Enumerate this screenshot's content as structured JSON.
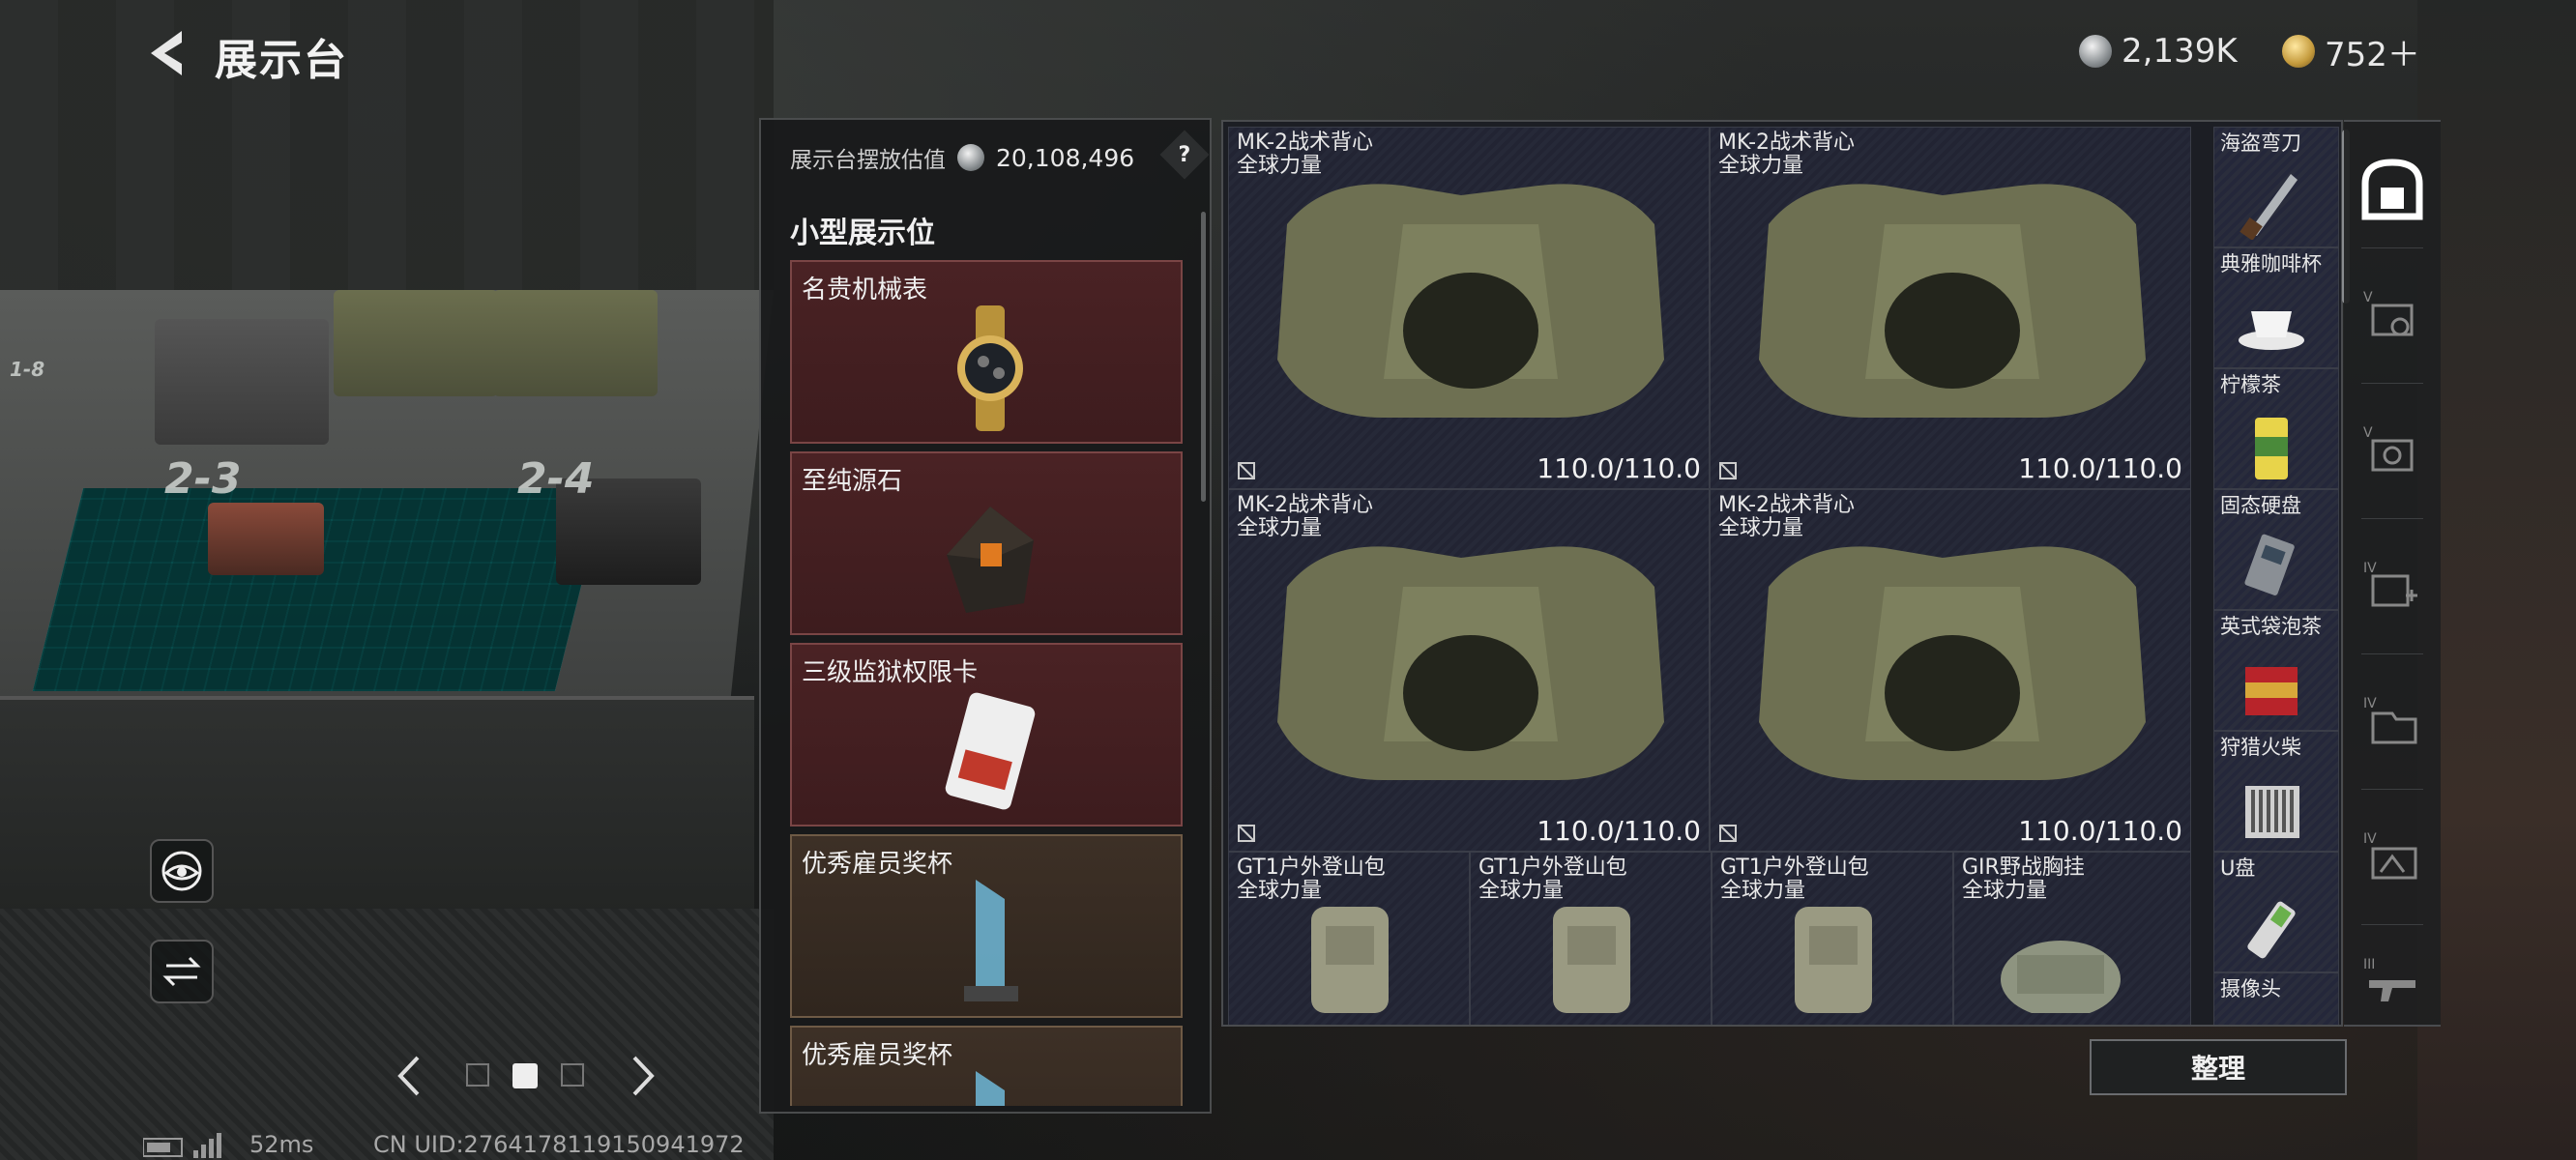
{
  "header": {
    "title": "展示台",
    "silver_amount": "2,139K",
    "gold_amount": "752＋"
  },
  "display_panel": {
    "value_label": "展示台摆放估值",
    "value_amount": "20,108,496",
    "help": "?",
    "section_title": "小型展示位",
    "slots": [
      {
        "name": "名贵机械表",
        "icon": "gold-watch-icon"
      },
      {
        "name": "至纯源石",
        "icon": "source-stone-icon"
      },
      {
        "name": "三级监狱权限卡",
        "icon": "access-card-icon"
      },
      {
        "name": "优秀雇员奖杯",
        "icon": "trophy-icon"
      },
      {
        "name": "优秀雇员奖杯",
        "icon": "trophy-icon"
      }
    ]
  },
  "warehouse": {
    "large_items": [
      {
        "name": "MK-2战术背心",
        "faction": "全球力量",
        "durability": "110.0/110.0"
      },
      {
        "name": "MK-2战术背心",
        "faction": "全球力量",
        "durability": "110.0/110.0"
      },
      {
        "name": "MK-2战术背心",
        "faction": "全球力量",
        "durability": "110.0/110.0"
      },
      {
        "name": "MK-2战术背心",
        "faction": "全球力量",
        "durability": "110.0/110.0"
      }
    ],
    "bags": [
      {
        "name": "GT1户外登山包",
        "faction": "全球力量"
      },
      {
        "name": "GT1户外登山包",
        "faction": "全球力量"
      },
      {
        "name": "GT1户外登山包",
        "faction": "全球力量"
      },
      {
        "name": "GIR野战胸挂",
        "faction": "全球力量"
      }
    ],
    "small_items": [
      {
        "name": "海盗弯刀",
        "icon": "knife-icon"
      },
      {
        "name": "典雅咖啡杯",
        "icon": "coffee-cup-icon"
      },
      {
        "name": "柠檬茶",
        "icon": "lemon-tea-can-icon"
      },
      {
        "name": "固态硬盘",
        "icon": "ssd-icon"
      },
      {
        "name": "英式袋泡茶",
        "icon": "tea-tin-icon"
      },
      {
        "name": "狩猎火柴",
        "icon": "matches-icon"
      },
      {
        "name": "U盘",
        "icon": "usb-drive-icon"
      },
      {
        "name": "摄像头",
        "icon": "camera-icon"
      }
    ],
    "organize_label": "整理"
  },
  "categories": [
    "all-items",
    "V-vest-gear",
    "V-vest-gear",
    "IV-medical",
    "IV-storage",
    "IV-container",
    "III-gun"
  ],
  "scene": {
    "slot_labels": [
      "1-8",
      "2-3",
      "2-4"
    ]
  },
  "status_bar": {
    "ping": "52ms",
    "uid": "CN UID:2764178119150941972"
  },
  "colors": {
    "slot_red": "#4a2224",
    "slot_brown": "#3d3026",
    "grid_bg": "#1c1e24",
    "accent_teal": "#177272"
  }
}
